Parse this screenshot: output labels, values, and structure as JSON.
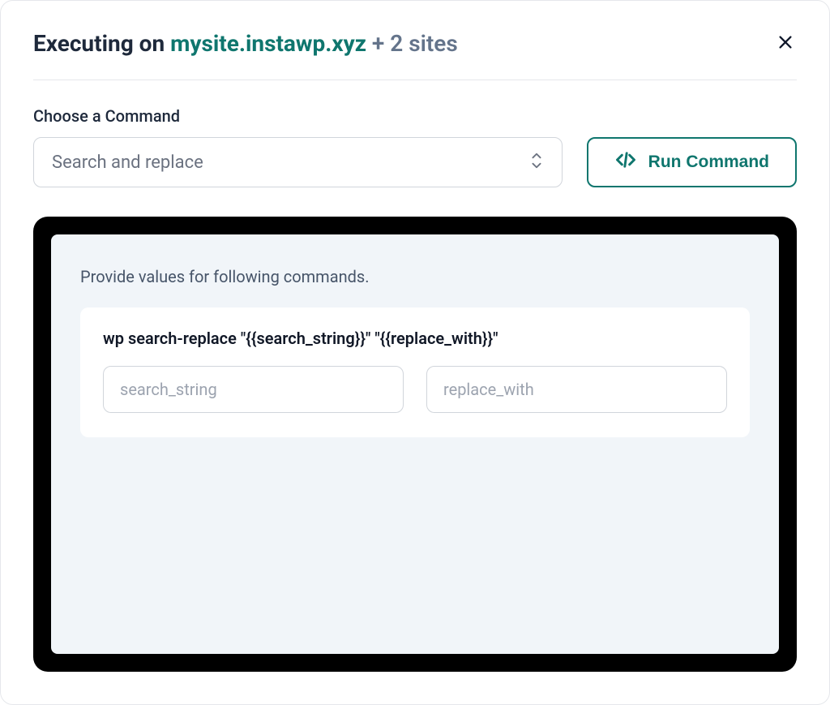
{
  "header": {
    "prefix": "Executing on ",
    "site": "mysite.instawp.xyz",
    "suffix": " + 2 sites"
  },
  "choose_label": "Choose a Command",
  "command_select": {
    "value": "Search and replace"
  },
  "run_button": {
    "label": "Run Command"
  },
  "terminal": {
    "provide_text": "Provide values for following commands.",
    "command": "wp search-replace \"{{search_string}}\" \"{{replace_with}}\"",
    "inputs": [
      {
        "placeholder": "search_string"
      },
      {
        "placeholder": "replace_with"
      }
    ]
  }
}
